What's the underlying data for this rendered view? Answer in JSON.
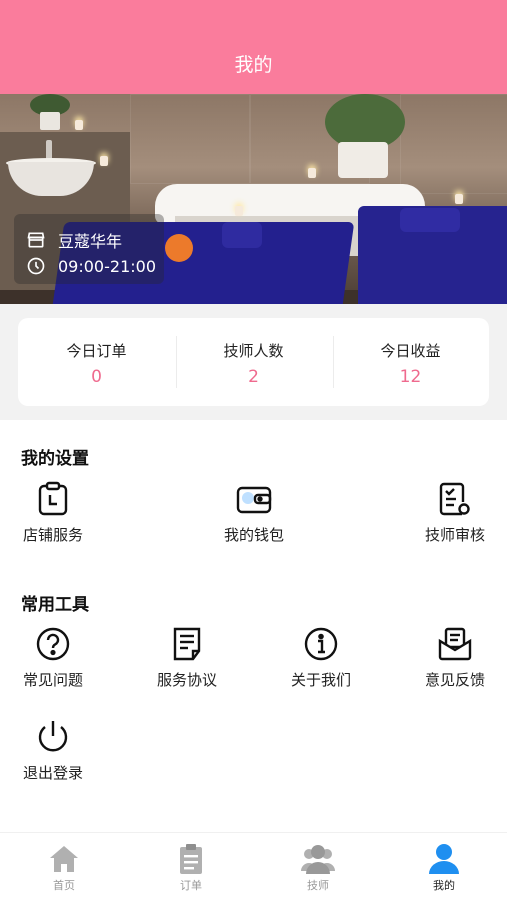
{
  "header": {
    "title": "我的"
  },
  "shop": {
    "name": "豆蔻华年",
    "hours": "09:00-21:00"
  },
  "stats": [
    {
      "label": "今日订单",
      "value": "0"
    },
    {
      "label": "技师人数",
      "value": "2"
    },
    {
      "label": "今日收益",
      "value": "12"
    }
  ],
  "settings": {
    "title": "我的设置",
    "items": [
      {
        "label": "店铺服务",
        "icon": "clipboard-clock-icon"
      },
      {
        "label": "我的钱包",
        "icon": "wallet-icon"
      },
      {
        "label": "技师审核",
        "icon": "checklist-icon"
      }
    ]
  },
  "tools": {
    "title": "常用工具",
    "items": [
      {
        "label": "常见问题",
        "icon": "question-icon"
      },
      {
        "label": "服务协议",
        "icon": "document-icon"
      },
      {
        "label": "关于我们",
        "icon": "info-icon"
      },
      {
        "label": "意见反馈",
        "icon": "feedback-mail-icon"
      },
      {
        "label": "退出登录",
        "icon": "power-icon"
      }
    ]
  },
  "tabbar": [
    {
      "label": "首页",
      "icon": "home-icon",
      "active": false
    },
    {
      "label": "订单",
      "icon": "order-icon",
      "active": false
    },
    {
      "label": "技师",
      "icon": "technician-icon",
      "active": false
    },
    {
      "label": "我的",
      "icon": "user-icon",
      "active": true
    }
  ],
  "colors": {
    "header": "#fa7c9c",
    "accent": "#ef6a8e",
    "tab_active": "#1f8ff0",
    "tab_inactive": "#b0b0b0"
  }
}
